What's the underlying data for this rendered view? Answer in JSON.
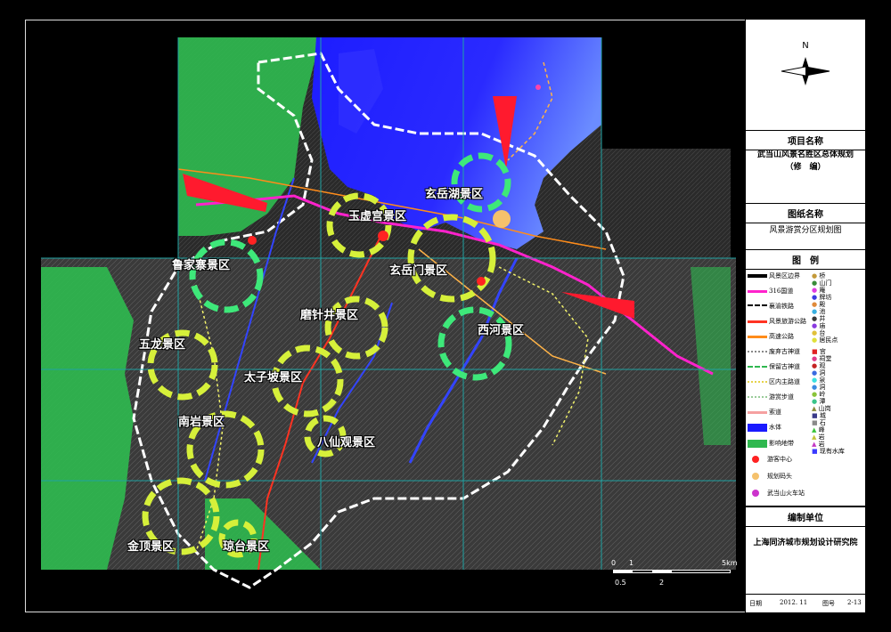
{
  "north_label": "N",
  "zones": [
    {
      "name": "玉虚宫景区"
    },
    {
      "name": "玄岳湖景区"
    },
    {
      "name": "鲁家寨景区"
    },
    {
      "name": "玄岳门景区"
    },
    {
      "name": "磨针井景区"
    },
    {
      "name": "五龙景区"
    },
    {
      "name": "西河景区"
    },
    {
      "name": "太子坡景区"
    },
    {
      "name": "南岩景区"
    },
    {
      "name": "八仙观景区"
    },
    {
      "name": "金顶景区"
    },
    {
      "name": "琼台景区"
    }
  ],
  "scale_bar": {
    "labels_top": [
      "0",
      "1",
      "5km"
    ],
    "labels_bottom": [
      "0.5",
      "2"
    ]
  },
  "panel": {
    "project_title": "项目名称",
    "project_name_line1": "武当山风景名胜区总体规划",
    "project_name_line2": "（修　编）",
    "drawing_title": "图纸名称",
    "drawing_name": "风景游赏分区规划图",
    "legend_title": "图　例",
    "legend_left": [
      "风景区边界",
      "316国道",
      "襄渝铁路",
      "风景旅游公路",
      "高速公路",
      "废弃古神道",
      "保留古神道",
      "区内主路道",
      "游赏步道",
      "索道",
      "水体",
      "影响地带",
      "游客中心",
      "规划码头",
      "武当山火车站"
    ],
    "legend_right": [
      "桥",
      "山门",
      "庵",
      "牌坊",
      "殿",
      "池",
      "井",
      "庙",
      "台",
      "居民点",
      "宫",
      "祠堂",
      "观",
      "洞",
      "泉",
      "洞",
      "岭",
      "潭",
      "山岗",
      "城",
      "石",
      "峰",
      "岩",
      "岩",
      "现有水库"
    ],
    "org_title": "编制单位",
    "org_name": "上海同济城市规划设计研究院",
    "date_label": "日期",
    "date_value": "2012. 11",
    "sheet_label": "图号",
    "sheet_value": "2-13"
  },
  "colors": {
    "zone_yellow": "#d6f03a",
    "zone_green": "#3ee87a",
    "water": "#1a1aff",
    "green_belt": "#2fb84f",
    "boundary": "#ffffff",
    "arrow": "#ff1a2e"
  }
}
